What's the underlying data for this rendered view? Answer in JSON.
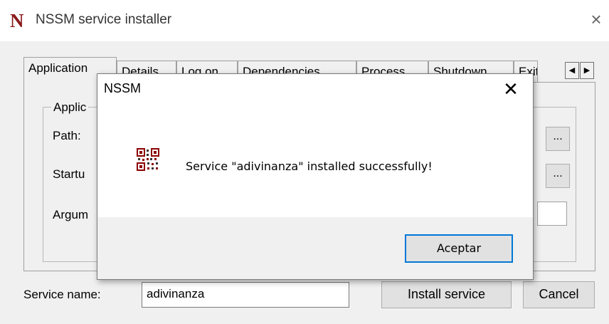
{
  "window": {
    "app_icon_letter": "N",
    "title": "NSSM service installer",
    "close_glyph": "×"
  },
  "tabs": [
    {
      "label": "Application",
      "active": true
    },
    {
      "label": "Details",
      "active": false
    },
    {
      "label": "Log on",
      "active": false
    },
    {
      "label": "Dependencies",
      "active": false
    },
    {
      "label": "Process",
      "active": false
    },
    {
      "label": "Shutdown",
      "active": false
    },
    {
      "label": "Exit",
      "active": false
    }
  ],
  "tab_scroll": {
    "left": "◀",
    "right": "▶"
  },
  "application_group": {
    "legend": "Applic",
    "path_label": "Path:",
    "startup_label": "Startu",
    "arguments_label": "Argum",
    "browse_label": "..."
  },
  "bottom": {
    "service_name_label": "Service name:",
    "service_name_value": "adivinanza",
    "install_label": "Install service",
    "cancel_label": "Cancel"
  },
  "dialog": {
    "title": "NSSM",
    "close_glyph": "✕",
    "icon": "qr-code-icon",
    "message": "Service \"adivinanza\" installed successfully!",
    "ok_label": "Aceptar",
    "accent_color": "#0078d7"
  }
}
